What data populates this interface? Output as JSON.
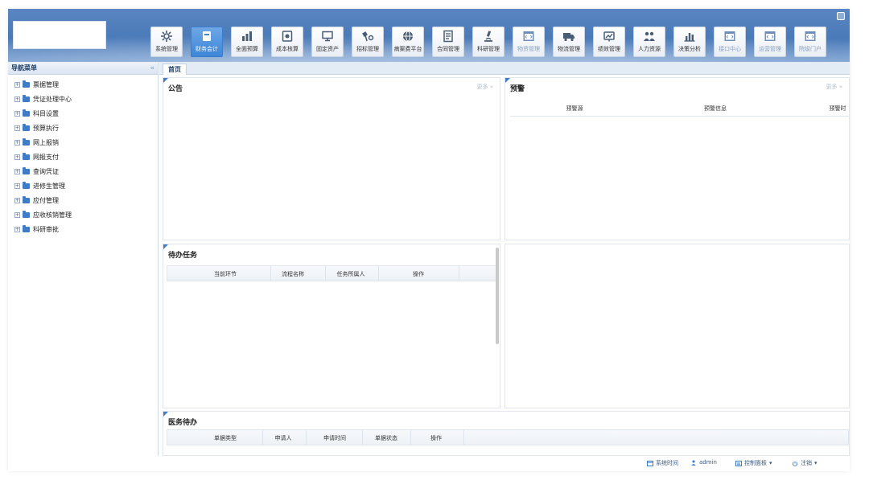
{
  "modules": [
    {
      "label": "系统管理",
      "icon": "gear-icon",
      "state": "normal"
    },
    {
      "label": "财务会计",
      "icon": "ledger-icon",
      "state": "active"
    },
    {
      "label": "全面预算",
      "icon": "budget-icon",
      "state": "normal"
    },
    {
      "label": "成本核算",
      "icon": "cost-icon",
      "state": "normal"
    },
    {
      "label": "固定资产",
      "icon": "monitor-icon",
      "state": "normal"
    },
    {
      "label": "招标管理",
      "icon": "bid-icon",
      "state": "normal"
    },
    {
      "label": "病案费平台",
      "icon": "globe-icon",
      "state": "normal"
    },
    {
      "label": "合同管理",
      "icon": "contract-icon",
      "state": "normal"
    },
    {
      "label": "科研管理",
      "icon": "microscope-icon",
      "state": "normal"
    },
    {
      "label": "物资管理",
      "icon": "code-window-icon",
      "state": "dim"
    },
    {
      "label": "物流管理",
      "icon": "truck-icon",
      "state": "normal"
    },
    {
      "label": "绩效管理",
      "icon": "performance-icon",
      "state": "normal"
    },
    {
      "label": "人力资源",
      "icon": "people-icon",
      "state": "normal"
    },
    {
      "label": "决策分析",
      "icon": "bar-chart-icon",
      "state": "normal"
    },
    {
      "label": "接口中心",
      "icon": "code-window-icon",
      "state": "dim"
    },
    {
      "label": "运营管理",
      "icon": "code-window-icon",
      "state": "dim"
    },
    {
      "label": "院级门户",
      "icon": "code-window-icon",
      "state": "dim"
    }
  ],
  "sidebar": {
    "title": "导航菜单",
    "collapse_glyph": "«",
    "items": [
      "票据管理",
      "凭证处理中心",
      "科目设置",
      "预算执行",
      "网上报销",
      "网报支付",
      "查询凭证",
      "进修生管理",
      "应付管理",
      "应收核销管理",
      "科研审批"
    ]
  },
  "tabs": [
    {
      "label": "首页"
    }
  ],
  "panels": {
    "notice": {
      "title": "公告",
      "more": "更多 »"
    },
    "warning": {
      "title": "预警",
      "more": "更多 »",
      "columns": [
        "预警源",
        "预警信息",
        "预警时"
      ]
    },
    "todo": {
      "title": "待办任务",
      "columns": [
        "当前环节",
        "流程名称",
        "任务所属人",
        "操作"
      ]
    },
    "medical": {
      "title": "医务待办",
      "columns": [
        "单据类型",
        "申请人",
        "申请时间",
        "单据状态",
        "操作"
      ]
    }
  },
  "footer": {
    "system_time": "系统时间",
    "user": "admin",
    "control_panel": "控制面板",
    "logout": "注销"
  },
  "colors": {
    "header": "#4a7ab8",
    "accent": "#3f7cc7",
    "active_module": "#3d86d8"
  }
}
